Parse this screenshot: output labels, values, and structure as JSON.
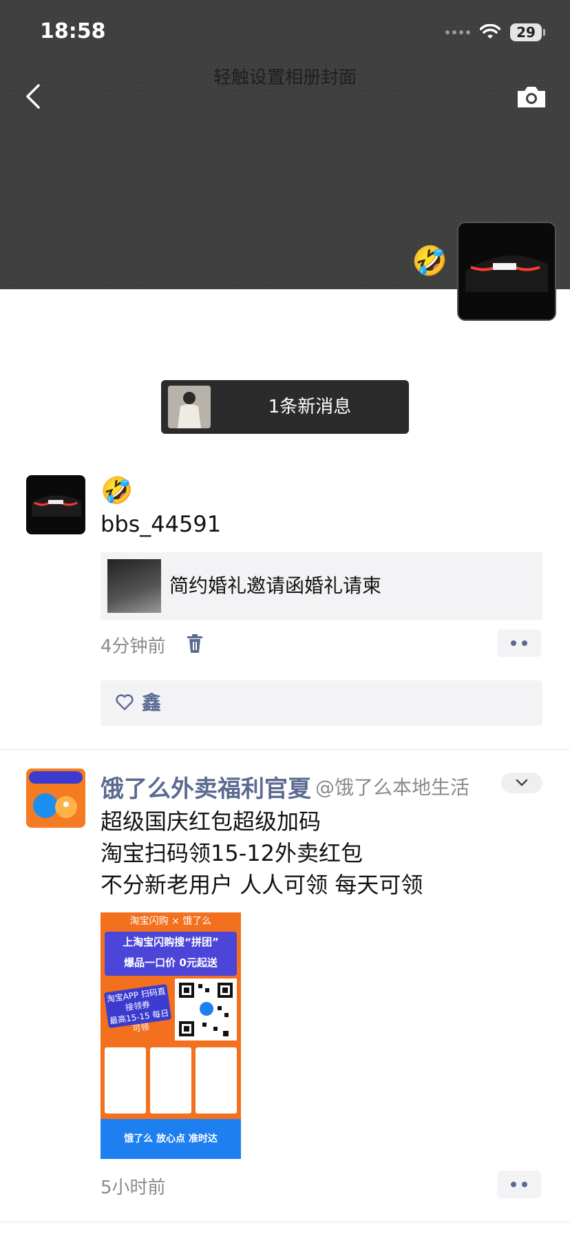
{
  "status_bar": {
    "time": "18:58",
    "battery": "29"
  },
  "cover": {
    "hint": "轻触设置相册封面",
    "owner_emoji": "🤣"
  },
  "new_message_banner": {
    "label": "1条新消息"
  },
  "posts": [
    {
      "name_emoji": "🤣",
      "username": "bbs_44591",
      "shared_title": "简约婚礼邀请函婚礼请柬",
      "time": "4分钟前",
      "likes": [
        "鑫"
      ]
    },
    {
      "account_name": "饿了么外卖福利官夏",
      "account_handle": "@饿了么本地生活",
      "text_lines": [
        "超级国庆红包超级加码",
        "淘宝扫码领15-12外卖红包",
        "不分新老用户 人人可领 每天可领"
      ],
      "image_text": {
        "top": "淘宝闪购 × 饿了么",
        "headline": "上淘宝闪购搜“拼团”",
        "subline": "爆品一口价 0元起送",
        "badge": "淘宝APP 扫码直接领券",
        "amount": "最高15-15 每日可领",
        "footer": "饿了么 放心点 准时达"
      },
      "time": "5小时前"
    }
  ]
}
